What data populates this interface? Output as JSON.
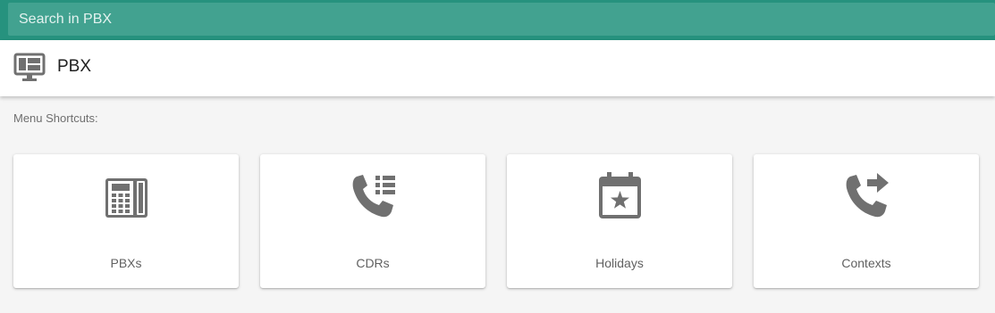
{
  "search": {
    "placeholder": "Search in PBX",
    "value": ""
  },
  "header": {
    "icon": "dashboard-monitor-icon",
    "title": "PBX"
  },
  "shortcuts": {
    "label": "Menu Shortcuts:",
    "items": [
      {
        "label": "PBXs",
        "icon": "desk-phone-icon"
      },
      {
        "label": "CDRs",
        "icon": "phone-log-icon"
      },
      {
        "label": "Holidays",
        "icon": "calendar-star-icon"
      },
      {
        "label": "Contexts",
        "icon": "phone-forward-icon"
      }
    ]
  },
  "colors": {
    "accent": "#26927e",
    "search_field": "#42a290",
    "icon": "#707070"
  }
}
